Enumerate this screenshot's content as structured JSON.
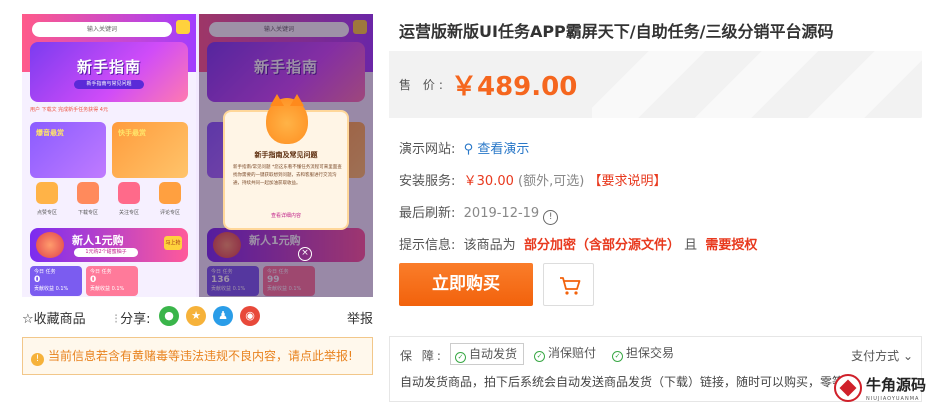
{
  "product": {
    "title": "运营版新版UI任务APP霸屏天下/自助任务/三级分销平台源码",
    "price_label": "售 价:",
    "price": "￥489.00"
  },
  "gallery": {
    "phone1": {
      "search_placeholder": "输入关键词",
      "banner_title": "新手指南",
      "banner_sub": "新手指南与常见问题",
      "notice": "用户 下载文  完成新手任务获得 4元",
      "card1": "爆音悬赏",
      "card2": "快手悬赏",
      "grid": [
        "优推荐",
        "领取赏",
        "全能推",
        "评论点",
        "分享收"
      ],
      "grid_labels": [
        "点赞专区",
        "下载专区",
        "关注专区",
        "评论专区"
      ],
      "promo_title": "新人1元购",
      "promo_sub": "1元购2个甜蜜柚子",
      "promo_tag": "马上抢",
      "stats": [
        {
          "label": "今日 任务",
          "value": "0",
          "sub": "贡献收益 0.1%"
        },
        {
          "label": "今日 任务",
          "value": "0",
          "sub": "贡献收益 0.1%"
        }
      ]
    },
    "phone2": {
      "search_placeholder": "输入关键词",
      "banner_title": "新手指南",
      "modal_title": "新手指南及常见问题",
      "modal_body": "新手指南/常见问题 *您这东看不懂任务流程可来里面查找你需要的一键获取想到问题，去和客服进行交流沟通，持续共同一起加油获取收益。",
      "modal_link": "查看详细内容",
      "promo_title": "新人1元购",
      "stats": [
        {
          "label": "今日 任务",
          "value": "136",
          "sub": "贡献收益 0.1%"
        },
        {
          "label": "今日 任务",
          "value": "99",
          "sub": "贡献收益 0.1%"
        }
      ]
    }
  },
  "actions": {
    "favorite": "☆收藏商品",
    "share": "分享:",
    "report": "举报",
    "share_icons": [
      "wechat-icon",
      "qzone-icon",
      "qq-icon",
      "weibo-icon"
    ]
  },
  "warning": "当前信息若含有黄赌毒等违法违规不良内容，请点此举报!",
  "info": {
    "demo_label": "演示网站:",
    "demo_link": "查看演示",
    "service_label": "安装服务:",
    "service_price": "￥30.00",
    "service_optional": "(额外,可选)",
    "service_required": "【要求说明】",
    "refresh_label": "最后刷新:",
    "refresh_date": "2019-12-19",
    "tips_label": "提示信息:",
    "tips_prefix": "该商品为",
    "tips_partial": "部分加密（含部分源文件）",
    "tips_mid": "且",
    "tips_auth": "需要授权"
  },
  "buttons": {
    "buy": "立即购买"
  },
  "guarantee": {
    "label": "保 障:",
    "items": [
      "自动发货",
      "消保赔付",
      "担保交易"
    ],
    "payment": "支付方式",
    "description": "自动发货商品，拍下后系统会自动发送商品发货（下载）链接，随时可以购买，零等待"
  },
  "watermark": {
    "name": "牛角源码",
    "sub": "NIUJIAOYUANMA"
  },
  "colors": {
    "accent_orange": "#f5661e",
    "price_red": "#e8391e",
    "link_blue": "#2a78c8",
    "check_green": "#3aa846"
  }
}
